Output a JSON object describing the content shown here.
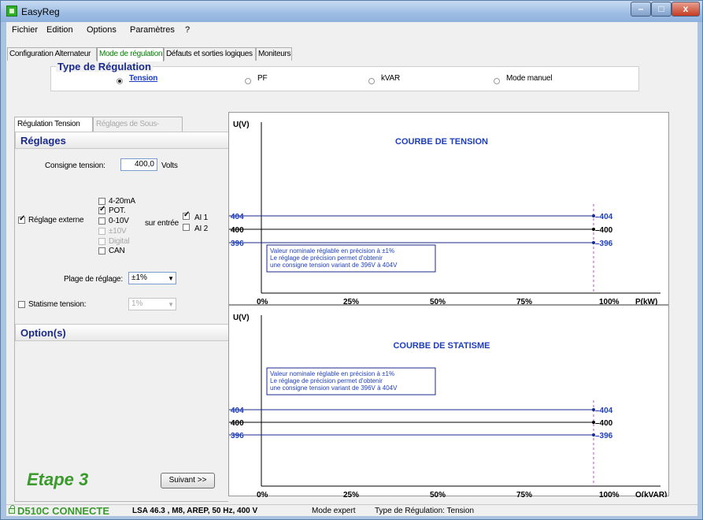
{
  "window": {
    "title": "EasyReg"
  },
  "menu": [
    "Fichier",
    "Edition",
    "Options",
    "Paramètres",
    "?"
  ],
  "top_tabs": [
    "Configuration Alternateur",
    "Mode de régulation",
    "Défauts et sorties logiques",
    "Moniteurs"
  ],
  "regulation_type": {
    "title": "Type de Régulation",
    "options": [
      "Tension",
      "PF",
      "kVAR",
      "Mode manuel"
    ],
    "selected": "Tension"
  },
  "sub_tabs": [
    "Régulation Tension",
    "Réglages de Sous-Vitesse"
  ],
  "settings": {
    "header": "Réglages",
    "setpoint_label": "Consigne tension:",
    "setpoint_value": "400,0",
    "setpoint_unit": "Volts",
    "external_label": "Réglage externe",
    "sources": [
      {
        "label": "4-20mA",
        "checked": false,
        "enabled": true
      },
      {
        "label": "POT.",
        "checked": true,
        "enabled": true
      },
      {
        "label": "0-10V",
        "checked": false,
        "enabled": true
      },
      {
        "label": "±10V",
        "checked": false,
        "enabled": false
      },
      {
        "label": "Digital",
        "checked": false,
        "enabled": false
      },
      {
        "label": "CAN",
        "checked": false,
        "enabled": true
      }
    ],
    "input_label": "sur entrée",
    "inputs": [
      {
        "label": "AI 1",
        "checked": true
      },
      {
        "label": "AI 2",
        "checked": false
      }
    ],
    "range_label": "Plage de réglage:",
    "range_value": "±1%",
    "droop_label": "Statisme tension:",
    "droop_value": "1%"
  },
  "options": {
    "header": "Option(s)"
  },
  "step": {
    "label": "Etape 3",
    "next_button": "Suivant >>"
  },
  "charts": [
    {
      "ylabel": "U(V)",
      "xlabel": "P(kW)",
      "title": "COURBE DE TENSION",
      "note": [
        "Valeur nominale réglable en précision à ±1%",
        "Le réglage de précision permet d'obtenir",
        "une consigne tension variant de 396V à 404V"
      ]
    },
    {
      "ylabel": "U(V)",
      "xlabel": "Q(kVAR)",
      "title": "COURBE DE STATISME",
      "note": [
        "Valeur nominale réglable en précision à ±1%",
        "Le réglage de précision permet d'obtenir",
        "une consigne tension variant de 396V à 404V"
      ]
    }
  ],
  "chart_data": [
    {
      "type": "line",
      "title": "COURBE DE TENSION",
      "xlabel": "P(kW)",
      "ylabel": "U(V)",
      "x_ticks": [
        "0%",
        "25%",
        "50%",
        "75%",
        "100%"
      ],
      "x": [
        0,
        100
      ],
      "series": [
        {
          "name": "404",
          "values": [
            404,
            404
          ],
          "color": "#1a2a8c"
        },
        {
          "name": "400",
          "values": [
            400,
            400
          ],
          "color": "#000000"
        },
        {
          "name": "396",
          "values": [
            396,
            396
          ],
          "color": "#1a2a8c"
        }
      ]
    },
    {
      "type": "line",
      "title": "COURBE DE STATISME",
      "xlabel": "Q(kVAR)",
      "ylabel": "U(V)",
      "x_ticks": [
        "0%",
        "25%",
        "50%",
        "75%",
        "100%"
      ],
      "x": [
        0,
        100
      ],
      "series": [
        {
          "name": "404",
          "values": [
            404,
            404
          ],
          "color": "#1a2a8c"
        },
        {
          "name": "400",
          "values": [
            400,
            400
          ],
          "color": "#000000"
        },
        {
          "name": "396",
          "values": [
            396,
            396
          ],
          "color": "#1a2a8c"
        }
      ]
    }
  ],
  "status": {
    "device": "D510C CONNECTE",
    "machine": "LSA 46.3  , M8, AREP, 50 Hz, 400 V",
    "mode": "Mode expert",
    "regulation": "Type de Régulation: Tension"
  }
}
